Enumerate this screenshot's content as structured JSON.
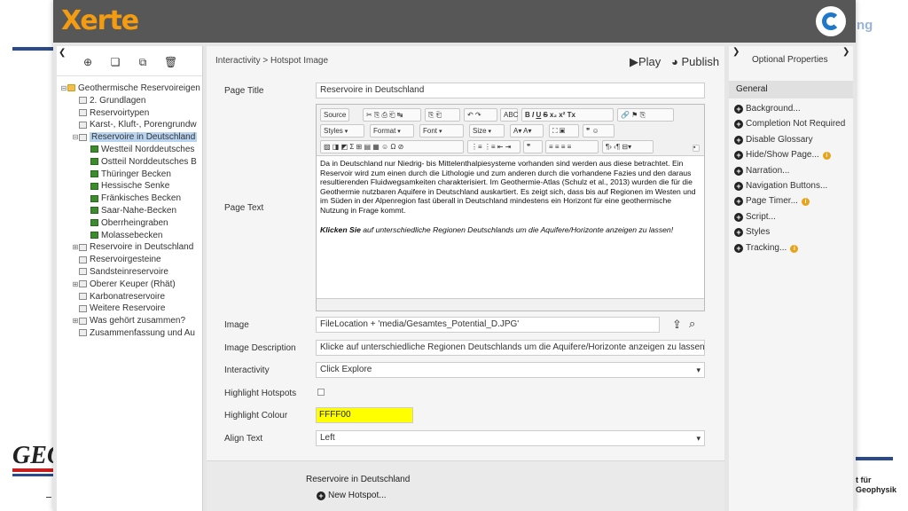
{
  "app": {
    "brand": "Xerte"
  },
  "background": {
    "corner_text": "ng",
    "left_logo": "GEO",
    "right_text_line1": "t für",
    "right_text_line2": "Geophysik"
  },
  "tree": {
    "items": [
      {
        "label": "Geothermische Reservoireigen",
        "level": 0,
        "icon": "folder",
        "exp": "⊟"
      },
      {
        "label": "2. Grundlagen",
        "level": 1,
        "icon": "page",
        "exp": ""
      },
      {
        "label": "Reservoirtypen",
        "level": 1,
        "icon": "page",
        "exp": ""
      },
      {
        "label": "Karst-, Kluft-, Porengrundw",
        "level": 1,
        "icon": "page",
        "exp": ""
      },
      {
        "label": "Reservoire in Deutschland",
        "level": 1,
        "icon": "page",
        "exp": "⊟",
        "selected": true
      },
      {
        "label": "Westteil Norddeutsches",
        "level": 2,
        "icon": "green",
        "exp": ""
      },
      {
        "label": "Ostteil Norddeutsches B",
        "level": 2,
        "icon": "green",
        "exp": ""
      },
      {
        "label": "Thüringer Becken",
        "level": 2,
        "icon": "green",
        "exp": ""
      },
      {
        "label": "Hessische Senke",
        "level": 2,
        "icon": "green",
        "exp": ""
      },
      {
        "label": "Fränkisches Becken",
        "level": 2,
        "icon": "green",
        "exp": ""
      },
      {
        "label": "Saar-Nahe-Becken",
        "level": 2,
        "icon": "green",
        "exp": ""
      },
      {
        "label": "Oberrheingraben",
        "level": 2,
        "icon": "green",
        "exp": ""
      },
      {
        "label": "Molassebecken",
        "level": 2,
        "icon": "green",
        "exp": ""
      },
      {
        "label": "Reservoire in Deutschland",
        "level": 1,
        "icon": "page",
        "exp": "⊞"
      },
      {
        "label": "Reservoirgesteine",
        "level": 1,
        "icon": "page",
        "exp": ""
      },
      {
        "label": "Sandsteinreservoire",
        "level": 1,
        "icon": "page",
        "exp": ""
      },
      {
        "label": "Oberer Keuper (Rhät)",
        "level": 1,
        "icon": "page",
        "exp": "⊞"
      },
      {
        "label": "Karbonatreservoire",
        "level": 1,
        "icon": "page",
        "exp": ""
      },
      {
        "label": "Weitere Reservoire",
        "level": 1,
        "icon": "page",
        "exp": ""
      },
      {
        "label": "Was gehört zusammen?",
        "level": 1,
        "icon": "page",
        "exp": "⊞"
      },
      {
        "label": "Zusammenfassung und Au",
        "level": 1,
        "icon": "page",
        "exp": ""
      }
    ]
  },
  "main": {
    "breadcrumb": "Interactivity > Hotspot Image",
    "play_label": "Play",
    "publish_label": "Publish",
    "labels": {
      "page_title": "Page Title",
      "page_text": "Page Text",
      "image": "Image",
      "image_description": "Image Description",
      "interactivity": "Interactivity",
      "highlight_hotspots": "Highlight Hotspots",
      "highlight_colour": "Highlight Colour",
      "align_text": "Align Text"
    },
    "values": {
      "page_title": "Reservoire in Deutschland",
      "image": "FileLocation + 'media/Gesamtes_Potential_D.JPG'",
      "image_description": "Klicke auf unterschiedliche Regionen Deutschlands um die Aquifere/Horizonte anzeigen zu lassen.",
      "interactivity": "Click Explore",
      "highlight_colour": "FFFF00",
      "align_text": "Left"
    },
    "editor": {
      "toolbar": {
        "source": "Source",
        "styles": "Styles",
        "format": "Format",
        "font": "Font",
        "size": "Size"
      },
      "paragraph": "Da in Deutschland nur Niedrig- bis Mittelenthalpiesysteme vorhanden sind werden aus diese betrachtet. Ein Reservoir wird zum einen durch die Lithologie und zum anderen durch die vorhandene Fazies und den daraus resultierenden Fluidwegsamkeiten charakterisiert. Im Geothermie-Atlas (Schulz et al., 2013) wurden die für die Geothermie nutzbaren Aquifere in Deutschland auskartiert. Es zeigt sich, dass bis auf Regionen im Westen und im Süden in der Alpenregion fast überall in Deutschland mindestens ein Horizont für eine geothermische Nutzung in Frage kommt.",
      "instruction_bold": "Klicken Sie",
      "instruction_rest": " auf unterschiedliche Regionen Deutschlands um die Aquifere/Horizonte anzeigen zu lassen!"
    },
    "sub": {
      "title": "Reservoire in Deutschland",
      "new_hotspot": "New Hotspot..."
    }
  },
  "optional": {
    "title": "Optional Properties",
    "section": "General",
    "items": [
      {
        "label": "Background...",
        "info": false
      },
      {
        "label": "Completion Not Required",
        "info": false
      },
      {
        "label": "Disable Glossary",
        "info": false
      },
      {
        "label": "Hide/Show Page...",
        "info": true
      },
      {
        "label": "Narration...",
        "info": false
      },
      {
        "label": "Navigation Buttons...",
        "info": false
      },
      {
        "label": "Page Timer...",
        "info": true
      },
      {
        "label": "Script...",
        "info": false
      },
      {
        "label": "Styles",
        "info": false
      },
      {
        "label": "Tracking...",
        "info": true
      }
    ]
  }
}
